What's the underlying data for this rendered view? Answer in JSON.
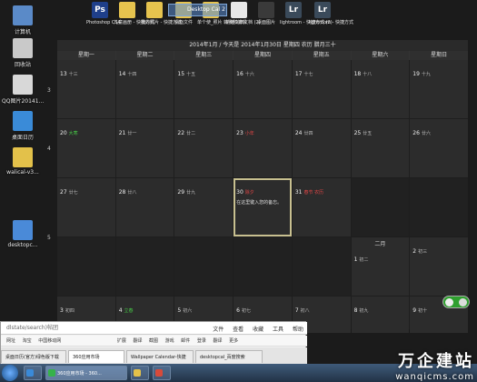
{
  "desktop_left_icons": [
    {
      "label": "计算机",
      "color": "#5a8ac8"
    },
    {
      "label": "回收站",
      "color": "#c9c9c9"
    },
    {
      "label": "QQ图片20141...",
      "color": "#d8d8d8"
    },
    {
      "label": "桌面日历",
      "color": "#3a8bd8"
    },
    {
      "label": "walical-v3...",
      "color": "#e3c14a"
    },
    {
      "label": "desktopc...",
      "color": "#4a8ad8"
    }
  ],
  "top_icons": [
    {
      "label": "Photoshop CS4",
      "glyph": "Ps",
      "color": "#1f3f8a"
    },
    {
      "label": "儿童画册 - 快捷方式",
      "glyph": "",
      "color": "#e6c34e"
    },
    {
      "label": "我的照片 - 快捷方式",
      "glyph": "",
      "color": "#e6c34e"
    },
    {
      "label": "桌面文件",
      "glyph": "",
      "color": "#e6c34e"
    },
    {
      "label": "单个使_照片 转换和编辑",
      "glyph": "",
      "color": "#e6c34e"
    },
    {
      "label": "新建文本文档 (2)",
      "glyph": "",
      "color": "#e8e8e8"
    },
    {
      "label": "桌面图片",
      "glyph": "",
      "color": "#3a3a3a"
    },
    {
      "label": "lightroom - 快捷方式 (2)",
      "glyph": "Lr",
      "color": "#3a4a5a"
    },
    {
      "label": "lightroom - 快捷方式",
      "glyph": "Lr",
      "color": "#3a4a5a"
    }
  ],
  "drag_label": "Desktop Cal 2",
  "calendar": {
    "title": "2014年1月 / 今天是 2014年1月30日 星期四 农历 腊月三十",
    "weekdays": [
      "星期一",
      "星期二",
      "星期三",
      "星期四",
      "星期五",
      "星期六",
      "星期日"
    ],
    "week_numbers": [
      "3",
      "4",
      "5"
    ],
    "today_note": "在这里键入您的备忘。",
    "month_tag": "二月",
    "rows": [
      [
        {
          "day": "13",
          "lunar": "十三",
          "style": ""
        },
        {
          "day": "14",
          "lunar": "十四",
          "style": ""
        },
        {
          "day": "15",
          "lunar": "十五",
          "style": ""
        },
        {
          "day": "16",
          "lunar": "十六",
          "style": ""
        },
        {
          "day": "17",
          "lunar": "十七",
          "style": ""
        },
        {
          "day": "18",
          "lunar": "十八",
          "style": ""
        },
        {
          "day": "19",
          "lunar": "十九",
          "style": ""
        }
      ],
      [
        {
          "day": "20",
          "lunar": "大寒",
          "style": "green"
        },
        {
          "day": "21",
          "lunar": "廿一",
          "style": ""
        },
        {
          "day": "22",
          "lunar": "廿二",
          "style": ""
        },
        {
          "day": "23",
          "lunar": "小年",
          "style": "red"
        },
        {
          "day": "24",
          "lunar": "廿四",
          "style": ""
        },
        {
          "day": "25",
          "lunar": "廿五",
          "style": ""
        },
        {
          "day": "26",
          "lunar": "廿六",
          "style": ""
        }
      ],
      [
        {
          "day": "27",
          "lunar": "廿七",
          "style": ""
        },
        {
          "day": "28",
          "lunar": "廿八",
          "style": ""
        },
        {
          "day": "29",
          "lunar": "廿九",
          "style": ""
        },
        {
          "day": "30",
          "lunar": "除夕",
          "style": "red"
        },
        {
          "day": "31",
          "lunar": "春节 农历",
          "style": "red"
        },
        {
          "day": "",
          "lunar": "",
          "style": ""
        },
        {
          "day": "",
          "lunar": "",
          "style": ""
        }
      ],
      [
        {
          "day": "",
          "lunar": "",
          "style": ""
        },
        {
          "day": "",
          "lunar": "",
          "style": ""
        },
        {
          "day": "",
          "lunar": "",
          "style": ""
        },
        {
          "day": "",
          "lunar": "",
          "style": ""
        },
        {
          "day": "",
          "lunar": "",
          "style": ""
        },
        {
          "day": "1",
          "lunar": "初二",
          "style": ""
        },
        {
          "day": "2",
          "lunar": "初三",
          "style": ""
        }
      ],
      [
        {
          "day": "3",
          "lunar": "初四",
          "style": ""
        },
        {
          "day": "4",
          "lunar": "立春",
          "style": "green"
        },
        {
          "day": "5",
          "lunar": "初六",
          "style": ""
        },
        {
          "day": "6",
          "lunar": "初七",
          "style": ""
        },
        {
          "day": "7",
          "lunar": "初八",
          "style": ""
        },
        {
          "day": "8",
          "lunar": "初九",
          "style": ""
        },
        {
          "day": "9",
          "lunar": "初十",
          "style": ""
        }
      ]
    ]
  },
  "browser": {
    "address": "dlstate/search)帖团",
    "menu": [
      "文件",
      "查看",
      "收藏",
      "工具",
      "帮助"
    ],
    "bookmarks": [
      "网址",
      "淘宝",
      "中国移动网",
      "扩展",
      "翻译",
      "截图",
      "游戏",
      "邮件",
      "登录",
      "翻译",
      "更多"
    ],
    "tabs": [
      "桌面日历(官方)绿色版下载",
      "360应用市场",
      "Wallpaper Calendar-快捷",
      "desktopcal_百度搜索"
    ]
  },
  "taskbar_items": [
    "",
    "360应用市场 - 360...",
    "",
    ""
  ],
  "watermark": {
    "title": "万企建站",
    "url": "wanqicms.com"
  }
}
